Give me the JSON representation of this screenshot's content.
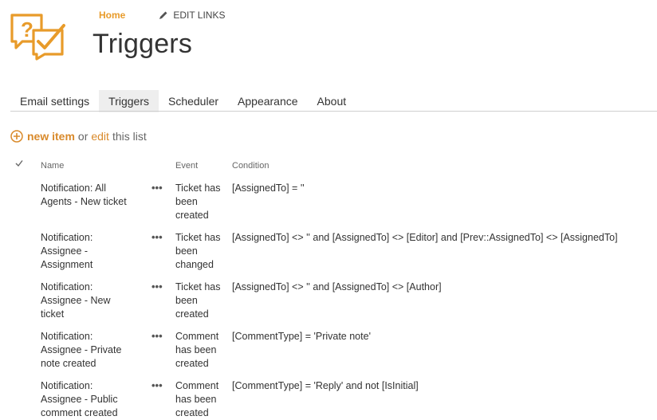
{
  "topnav": {
    "home": "Home",
    "edit_links": "EDIT LINKS"
  },
  "page": {
    "title": "Triggers"
  },
  "tabs": [
    {
      "label": "Email settings",
      "active": false
    },
    {
      "label": "Triggers",
      "active": true
    },
    {
      "label": "Scheduler",
      "active": false
    },
    {
      "label": "Appearance",
      "active": false
    },
    {
      "label": "About",
      "active": false
    }
  ],
  "toolbar": {
    "new_item": "new item",
    "or": "or",
    "edit": "edit",
    "this_list": "this list"
  },
  "columns": {
    "name": "Name",
    "event": "Event",
    "condition": "Condition"
  },
  "rows": [
    {
      "name": "Notification: All Agents - New ticket",
      "event": "Ticket has been created",
      "condition": "[AssignedTo] = ''"
    },
    {
      "name": "Notification: Assignee - Assignment",
      "event": "Ticket has been changed",
      "condition": "[AssignedTo] <> '' and [AssignedTo] <> [Editor] and [Prev::AssignedTo] <> [AssignedTo]"
    },
    {
      "name": "Notification: Assignee - New ticket",
      "event": "Ticket has been created",
      "condition": "[AssignedTo] <> '' and [AssignedTo] <> [Author]"
    },
    {
      "name": "Notification: Assignee - Private note created",
      "event": "Comment has been created",
      "condition": "[CommentType] = 'Private note'"
    },
    {
      "name": "Notification: Assignee - Public comment created",
      "event": "Comment has been created",
      "condition": "[CommentType] = 'Reply' and not [IsInitial]"
    }
  ],
  "colors": {
    "accent": "#e89b2a",
    "link": "#d98a2b"
  }
}
